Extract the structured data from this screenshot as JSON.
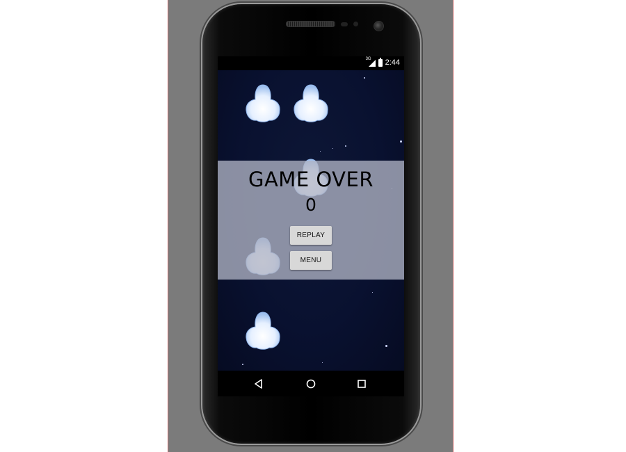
{
  "status_bar": {
    "network": "3G",
    "time": "2:44"
  },
  "game": {
    "title": "GAME OVER",
    "score": "0",
    "replay_label": "REPLAY",
    "menu_label": "MENU"
  },
  "nav": {
    "back": "back-icon",
    "home": "home-icon",
    "recents": "recents-icon"
  },
  "colors": {
    "emulator_bg": "#7b7b7b",
    "space_bg": "#091130",
    "overlay": "#b0b4c4",
    "button": "#d8d8d8"
  }
}
